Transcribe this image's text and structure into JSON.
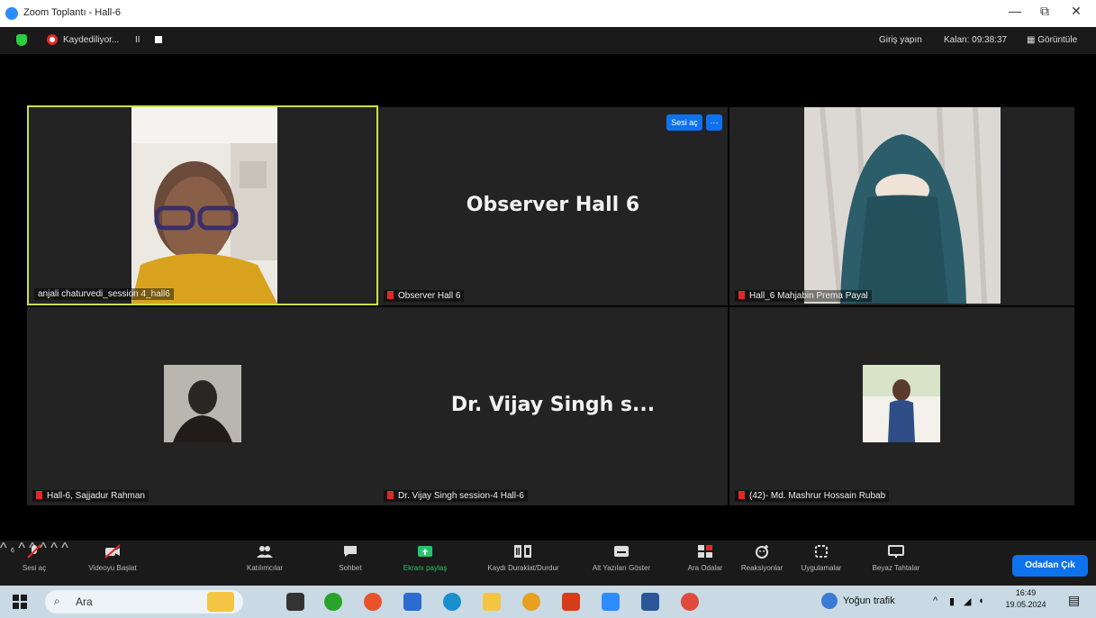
{
  "window": {
    "title": "Zoom Toplantı - Hall-6",
    "minimize": "—",
    "maximize": "⧉",
    "close": "✕"
  },
  "topbar": {
    "recording_label": "Kaydediliyor...",
    "pause_symbol": "II",
    "signin_label": "Giriş yapın",
    "timer_label": "Kalan: 09:38:37",
    "view_label": "Görüntüle"
  },
  "tiles": [
    {
      "name": "anjali chaturvedi_session 4_hall6",
      "muted": false,
      "active": true,
      "has_video": true
    },
    {
      "name": "Observer Hall 6",
      "muted": true,
      "active": false,
      "display_text": "Observer Hall 6",
      "unmute_button": "Sesi aç",
      "more_button": "···"
    },
    {
      "name": "Hall_6 Mahjabin Prema Payal",
      "muted": true,
      "active": false,
      "has_video": true
    },
    {
      "name": "Hall-6, Sajjadur Rahman",
      "muted": true,
      "active": false,
      "has_avatar": true
    },
    {
      "name": "Dr. Vijay Singh session-4 Hall-6",
      "muted": true,
      "active": false,
      "display_text": "Dr. Vijay Singh s..."
    },
    {
      "name": "(42)- Md. Mashrur Hossain Rubab",
      "muted": true,
      "active": false,
      "has_avatar": true
    }
  ],
  "toolbar": {
    "unmute": "Sesi aç",
    "start_video": "Videoyu Başlat",
    "participants": "Katılımcılar",
    "participants_count": "6",
    "chat": "Sohbet",
    "share_screen": "Ekranı paylaş",
    "pause_stop_recording": "Kaydı Duraklat/Durdur",
    "show_captions": "Alt Yazıları Göster",
    "breakout_rooms": "Ara Odalar",
    "reactions": "Reaksiyonlar",
    "apps": "Uygulamalar",
    "whiteboards": "Beyaz Tahtalar",
    "leave_rooms": "Odadan Çık"
  },
  "taskbar": {
    "search_placeholder": "Ara",
    "weather_label": "Yoğun trafik",
    "time": "16:49",
    "date": "19.05.2024"
  },
  "colors": {
    "accent": "#0e72ed",
    "active_speaker": "#c8e24a",
    "mute": "#e02828",
    "tile_bg": "#232323"
  }
}
